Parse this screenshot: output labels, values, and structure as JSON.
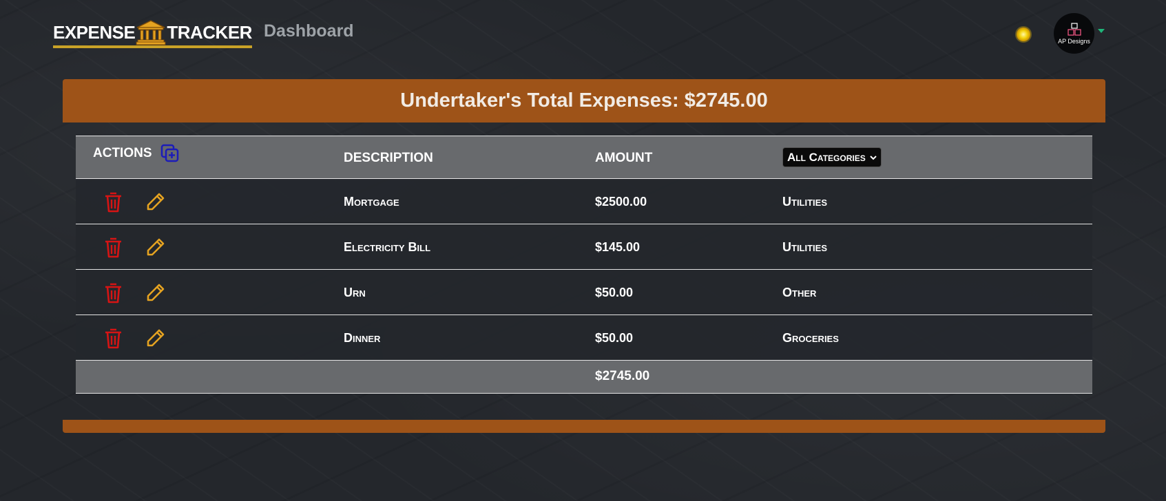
{
  "app": {
    "logo_left": "EXPENSE",
    "logo_right": "TRACKER",
    "nav_dashboard": "Dashboard",
    "avatar_label": "AP Designs"
  },
  "summary": {
    "title": "Undertaker's Total Expenses: $2745.00"
  },
  "table": {
    "headers": {
      "actions": "ACTIONS",
      "description": "DESCRIPTION",
      "amount": "AMOUNT"
    },
    "category_filter": "All Categories",
    "rows": [
      {
        "description": "Mortgage",
        "amount": "$2500.00",
        "category": "Utilities"
      },
      {
        "description": "Electricity Bill",
        "amount": "$145.00",
        "category": "Utilities"
      },
      {
        "description": "Urn",
        "amount": "$50.00",
        "category": "Other"
      },
      {
        "description": "Dinner",
        "amount": "$50.00",
        "category": "Groceries"
      }
    ],
    "footer_total": "$2745.00"
  },
  "colors": {
    "accent_orange": "#9e5318",
    "logo_gold": "#c9a227",
    "delete_red": "#d61414",
    "edit_yellow": "#e5a321",
    "add_blue": "#1c1cb8"
  },
  "icons": [
    "bank-icon",
    "sun-icon",
    "add-icon",
    "trash-icon",
    "pencil-icon",
    "chevron-down-icon"
  ]
}
